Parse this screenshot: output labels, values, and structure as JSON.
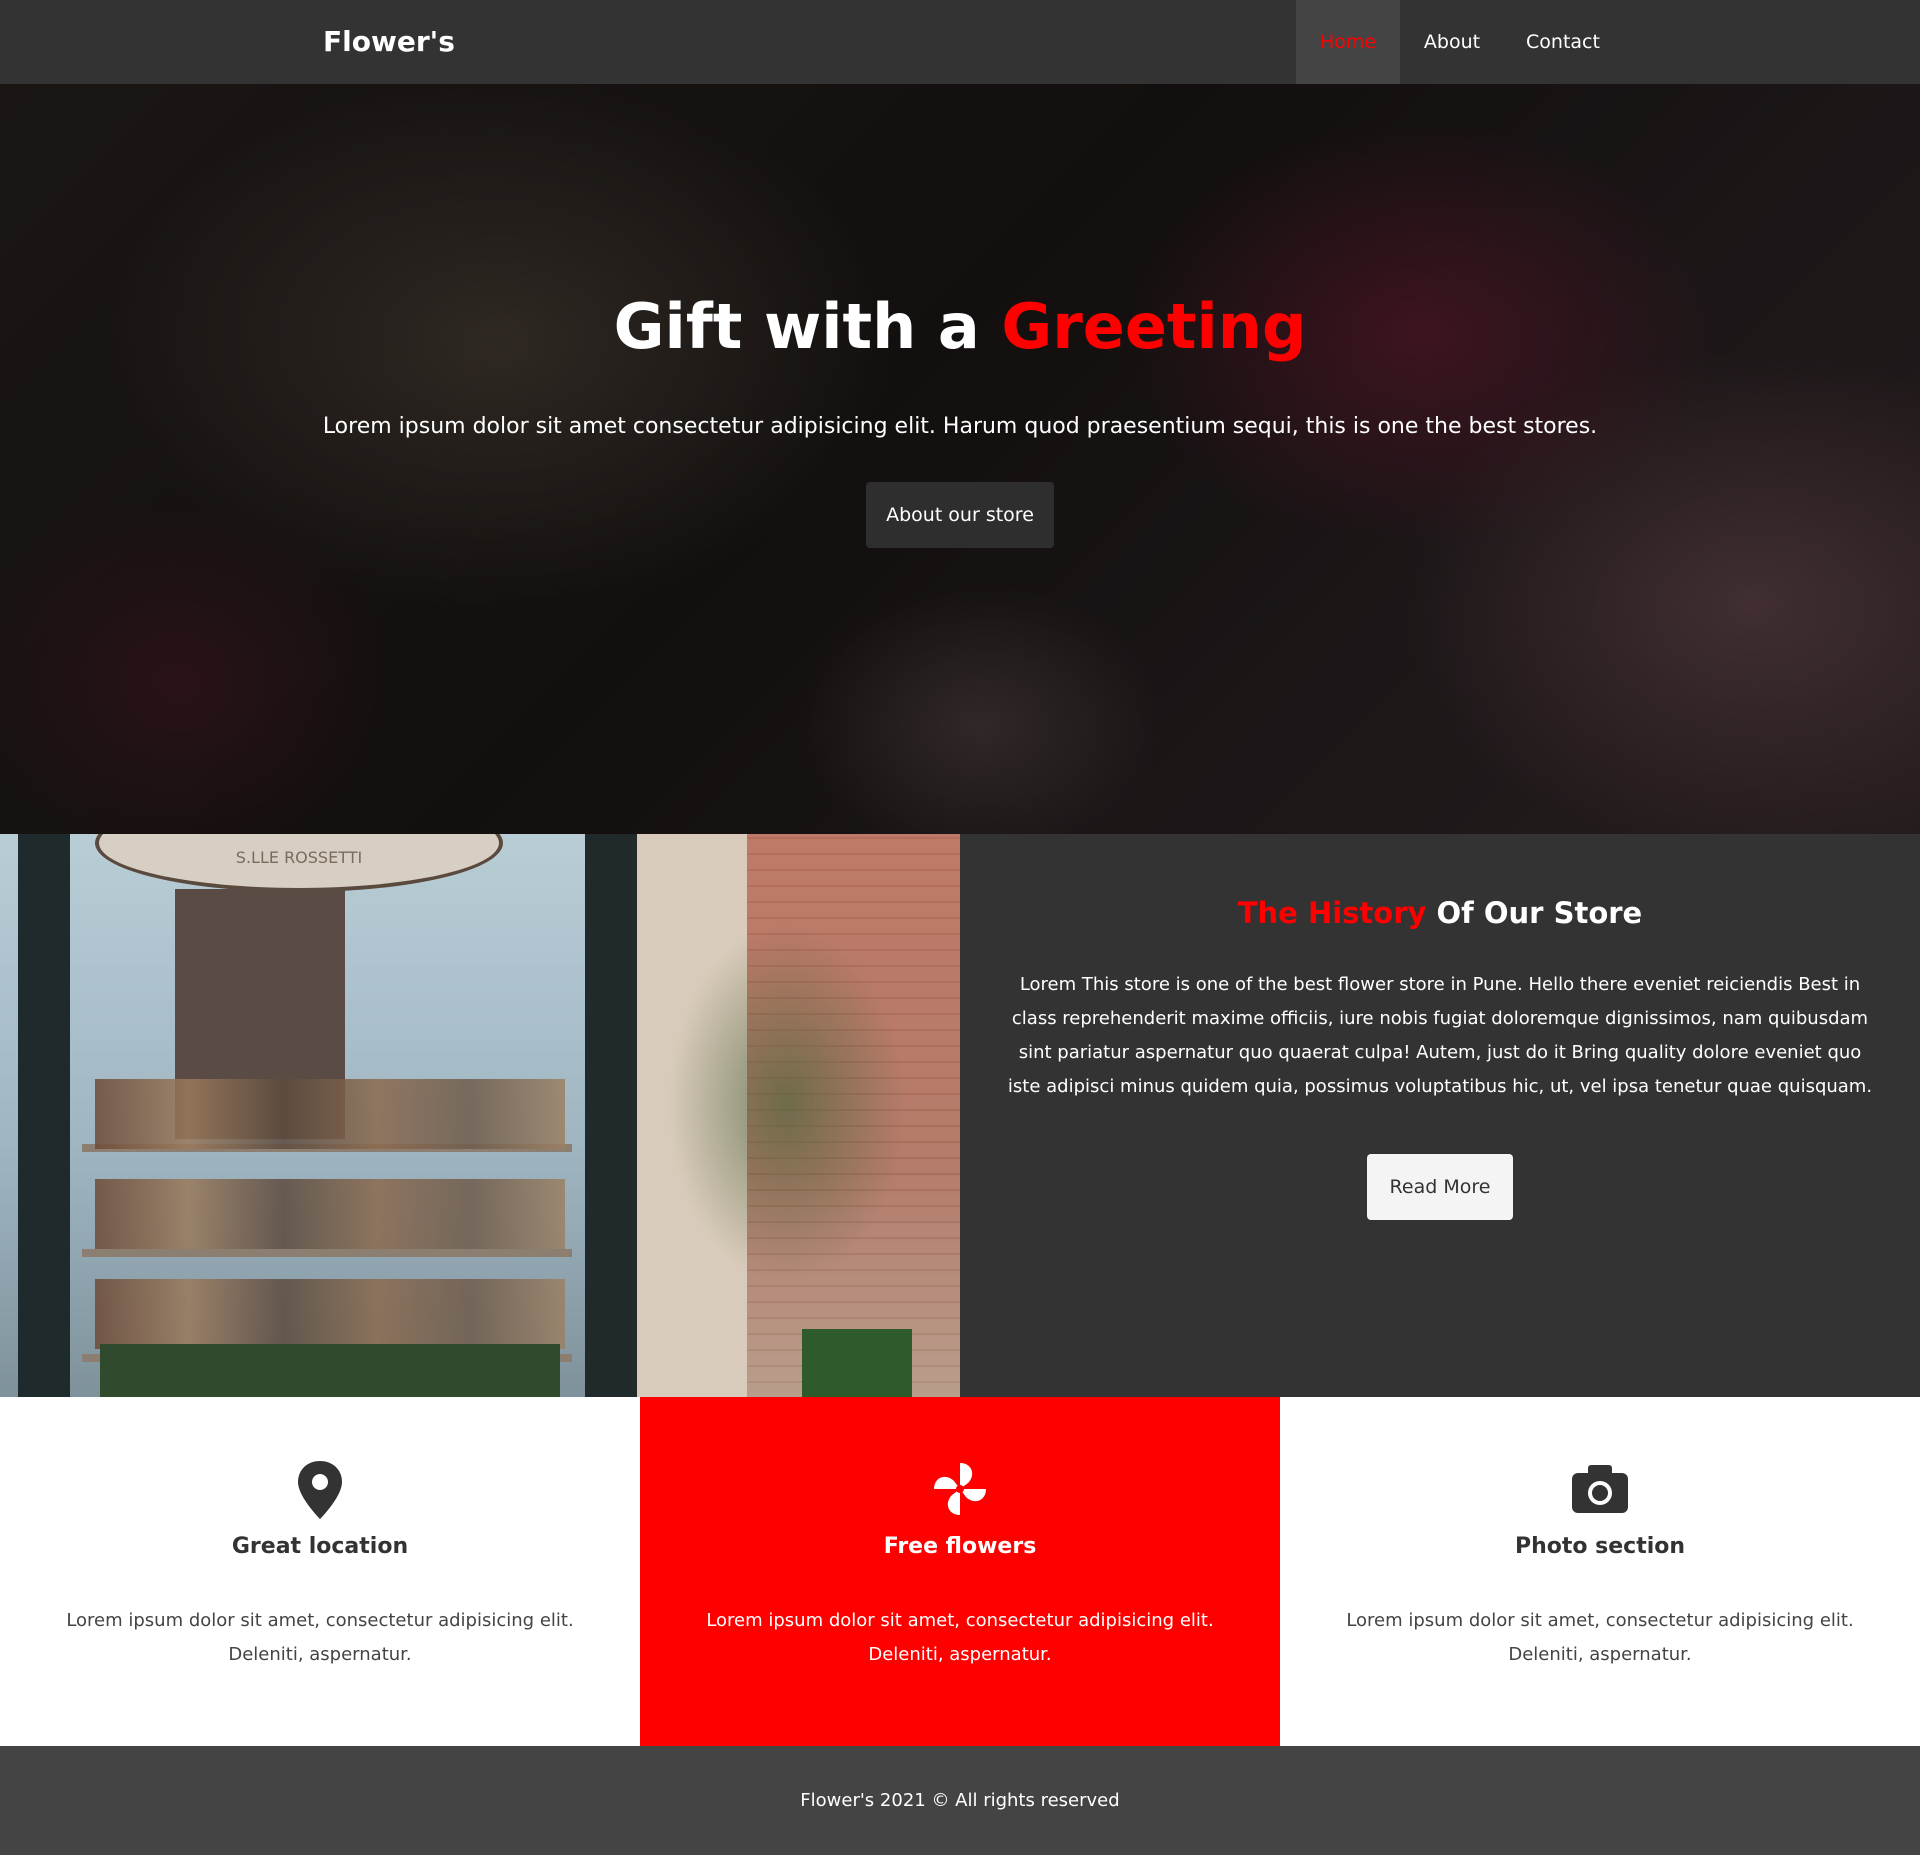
{
  "colors": {
    "accent": "#ff0000",
    "dark": "#333333",
    "footer": "#444444"
  },
  "nav": {
    "brand": "Flower's",
    "items": [
      {
        "label": "Home"
      },
      {
        "label": "About"
      },
      {
        "label": "Contact"
      }
    ]
  },
  "hero": {
    "title_main": "Gift with a",
    "title_accent": "Greeting",
    "subtitle": "Lorem ipsum dolor sit amet consectetur adipisicing elit. Harum quod praesentium sequi, this is one the best stores.",
    "button_label": "About our store"
  },
  "store": {
    "sign_text": "S.LLE ROSSETTI",
    "title_accent": "The History",
    "title_rest": "Of Our Store",
    "body": "Lorem This store is one of the best flower store in Pune. Hello there eveniet reiciendis Best in class reprehenderit maxime officiis, iure nobis fugiat doloremque dignissimos, nam quibusdam sint pariatur aspernatur quo quaerat culpa! Autem, just do it Bring quality dolore eveniet quo iste adipisci minus quidem quia, possimus voluptatibus hic, ut, vel ipsa tenetur quae quisquam.",
    "button_label": "Read More"
  },
  "features": [
    {
      "icon": "map-pin-icon",
      "title": "Great location",
      "text": "Lorem ipsum dolor sit amet, consectetur adipisicing elit. Deleniti, aspernatur."
    },
    {
      "icon": "pinwheel-icon",
      "title": "Free flowers",
      "text": "Lorem ipsum dolor sit amet, consectetur adipisicing elit. Deleniti, aspernatur."
    },
    {
      "icon": "camera-icon",
      "title": "Photo section",
      "text": "Lorem ipsum dolor sit amet, consectetur adipisicing elit. Deleniti, aspernatur."
    }
  ],
  "footer": {
    "text": "Flower's 2021 © All rights reserved"
  }
}
